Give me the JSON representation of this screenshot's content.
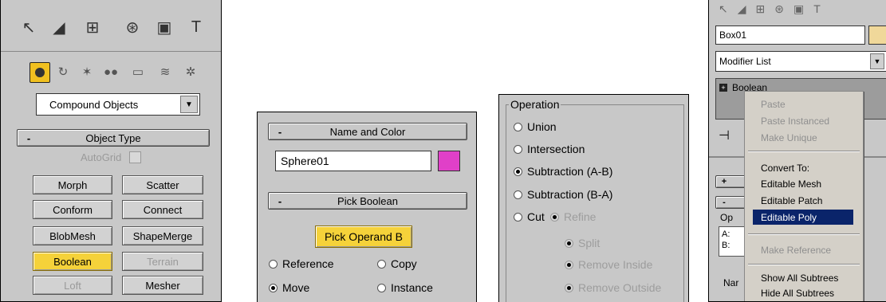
{
  "create_panel": {
    "tab_icons": [
      "pointer-icon",
      "curve-icon",
      "hierarchy-icon",
      "motion-icon",
      "display-icon",
      "hammer-icon"
    ],
    "sub_icons": [
      "sphere-icon",
      "shapes-icon",
      "lights-icon",
      "cameras-icon",
      "helpers-icon",
      "spacewarps-icon",
      "systems-icon"
    ],
    "category": "Compound Objects",
    "rollout_sign": "-",
    "rollout_title": "Object Type",
    "autogrid_label": "AutoGrid",
    "buttons": [
      "Morph",
      "Scatter",
      "Conform",
      "Connect",
      "BlobMesh",
      "ShapeMerge",
      "Boolean",
      "Terrain",
      "Loft",
      "Mesher"
    ]
  },
  "name_panel": {
    "rollout1_sign": "-",
    "rollout1_title": "Name and Color",
    "name_value": "Sphere01",
    "color": "#e040c8",
    "rollout2_sign": "-",
    "rollout2_title": "Pick Boolean",
    "pick_button": "Pick Operand B",
    "options": [
      "Reference",
      "Copy",
      "Move",
      "Instance"
    ]
  },
  "operation_panel": {
    "title": "Operation",
    "options": [
      "Union",
      "Intersection",
      "Subtraction (A-B)",
      "Subtraction (B-A)",
      "Cut"
    ],
    "cut_options": [
      "Refine",
      "Split",
      "Remove Inside",
      "Remove Outside"
    ]
  },
  "modify_panel": {
    "object_name": "Box01",
    "color": "#f0d89a",
    "modifier_list": "Modifier List",
    "stack_item": "Boolean",
    "group_label": "Op",
    "a_label": "A:",
    "b_label": "B:",
    "name_label": "Nar",
    "plus_sign": "+",
    "minus_sign": "-",
    "context_menu": [
      "Paste",
      "Paste Instanced",
      "Make Unique",
      "Convert To:",
      "Editable Mesh",
      "Editable Patch",
      "Editable Poly",
      "Make Reference",
      "Show All Subtrees",
      "Hide All Subtrees"
    ]
  }
}
